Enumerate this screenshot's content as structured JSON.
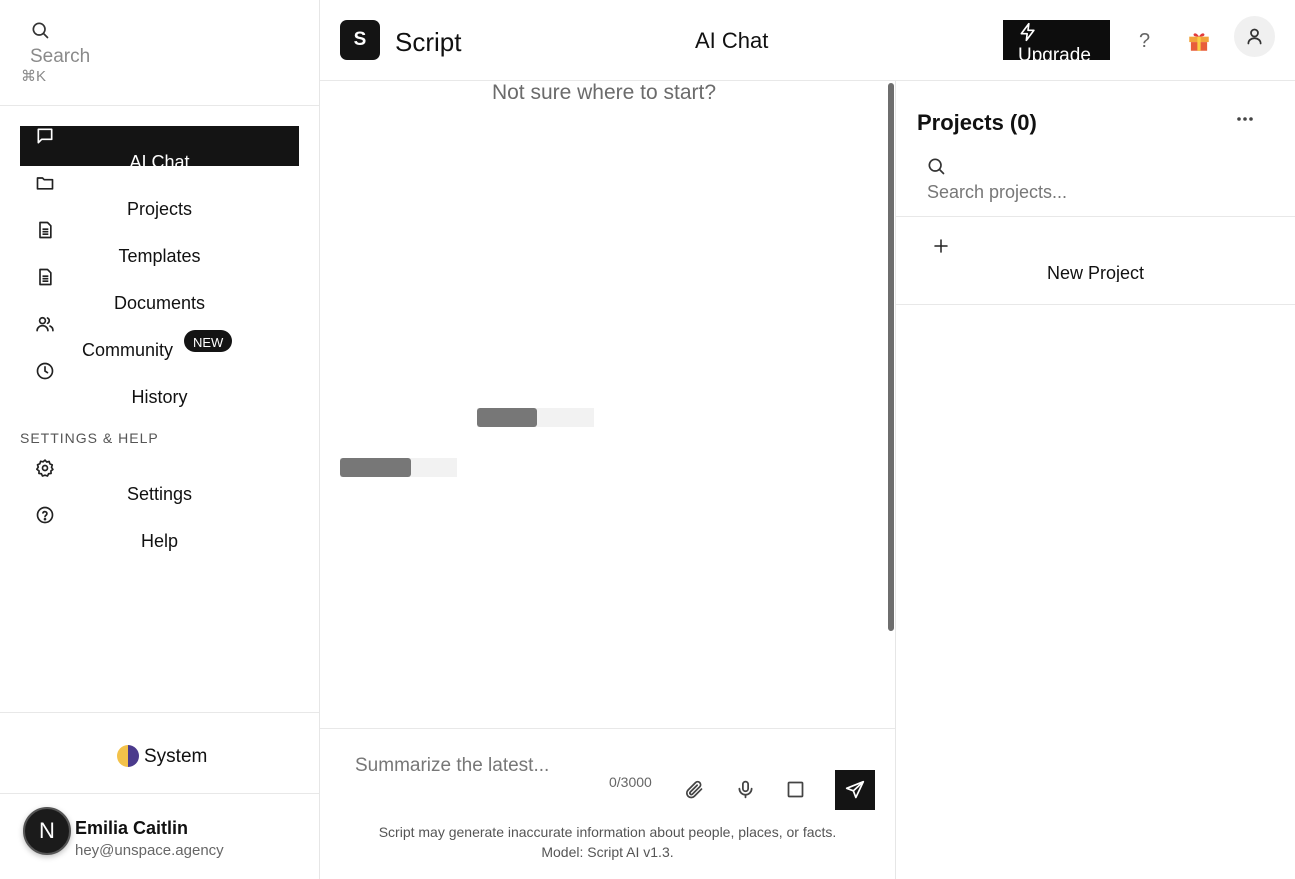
{
  "sidebar": {
    "search": {
      "placeholder": "Search",
      "shortcut": "⌘K"
    },
    "nav": [
      {
        "label": "AI Chat",
        "icon": "chat-icon",
        "active": true
      },
      {
        "label": "Projects",
        "icon": "folder-icon"
      },
      {
        "label": "Templates",
        "icon": "document-icon"
      },
      {
        "label": "Documents",
        "icon": "document-icon"
      },
      {
        "label": "Community",
        "icon": "users-icon",
        "badge": "NEW"
      },
      {
        "label": "History",
        "icon": "clock-icon"
      }
    ],
    "settings_section": {
      "title": "SETTINGS & HELP",
      "items": [
        {
          "label": "Settings",
          "icon": "gear-icon"
        },
        {
          "label": "Help",
          "icon": "help-circle-icon"
        }
      ]
    },
    "theme": {
      "label": "System"
    },
    "user": {
      "avatar_letter": "N",
      "name": "Emilia Caitlin",
      "email": "hey@unspace.agency"
    }
  },
  "header": {
    "logo_letter": "S",
    "brand": "Script",
    "title": "AI Chat",
    "upgrade_label": "Upgrade",
    "help_label": "?"
  },
  "chat": {
    "hint": "Not sure where to start?",
    "composer": {
      "placeholder": "Summarize the latest...",
      "counter": "0/3000"
    },
    "disclaimer_line1": "Script may generate inaccurate information about people, places, or facts.",
    "disclaimer_line2": "Model: Script AI v1.3."
  },
  "projects": {
    "title": "Projects (0)",
    "search_placeholder": "Search projects...",
    "new_project_label": "New Project"
  },
  "colors": {
    "accent": "#141414",
    "muted": "#777777",
    "border": "#e8e8e8"
  }
}
